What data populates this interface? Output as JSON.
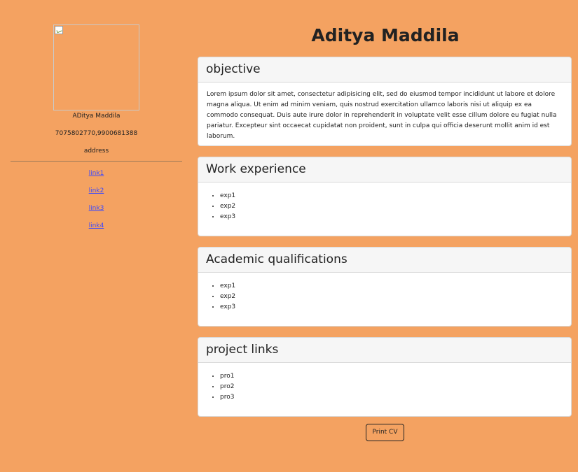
{
  "sidebar": {
    "name": "ADitya Maddila",
    "phone": "7075802770,9900681388",
    "address": "address",
    "links": [
      "link1",
      "link2",
      "link3",
      "link4"
    ]
  },
  "main": {
    "title": "Aditya Maddila",
    "sections": {
      "objective": {
        "heading": "objective",
        "text": "Lorem ipsum dolor sit amet, consectetur adipisicing elit, sed do eiusmod tempor incididunt ut labore et dolore magna aliqua. Ut enim ad minim veniam, quis nostrud exercitation ullamco laboris nisi ut aliquip ex ea commodo consequat. Duis aute irure dolor in reprehenderit in voluptate velit esse cillum dolore eu fugiat nulla pariatur. Excepteur sint occaecat cupidatat non proident, sunt in culpa qui officia deserunt mollit anim id est laborum."
      },
      "work": {
        "heading": "Work experience",
        "items": [
          "exp1",
          "exp2",
          "exp3"
        ]
      },
      "academic": {
        "heading": "Academic qualifications",
        "items": [
          "exp1",
          "exp2",
          "exp3"
        ]
      },
      "projects": {
        "heading": "project links",
        "items": [
          "pro1",
          "pro2",
          "pro3"
        ]
      }
    },
    "print_label": "Print CV"
  },
  "colors": {
    "background": "#f4a261",
    "card_background": "#ffffff",
    "card_header": "#f6f6f6",
    "link": "#3a49ff"
  },
  "icons": {
    "profile_image": "broken-image-icon"
  }
}
